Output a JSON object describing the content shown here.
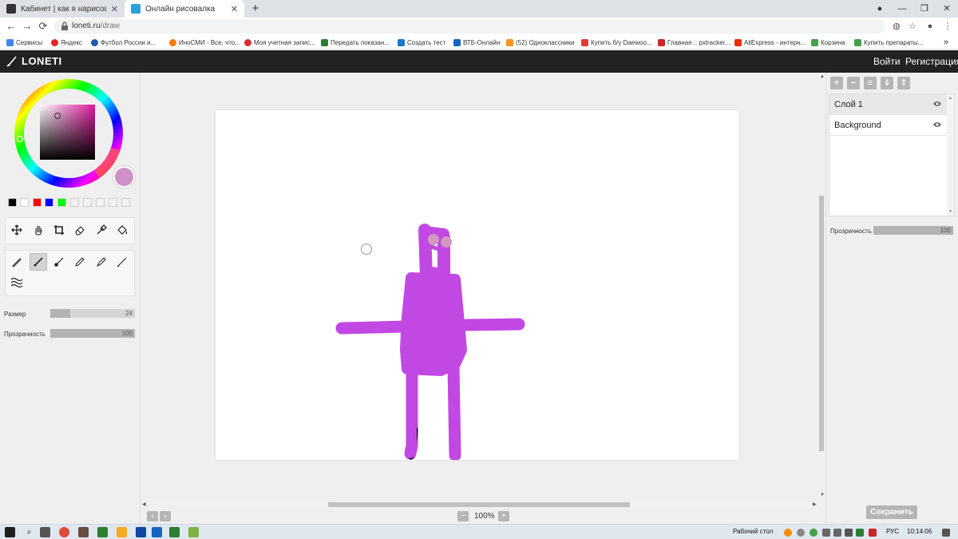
{
  "browser": {
    "tabs": [
      {
        "title": "Кабинет | как я нарисовал моб",
        "active": false
      },
      {
        "title": "Онлайн рисовалка",
        "active": true
      }
    ],
    "new_tab": "+",
    "url_domain": "loneti.ru",
    "url_path": "/draw",
    "bookmarks": [
      {
        "label": "Сервисы",
        "color": "#4285f4"
      },
      {
        "label": "Яндекс",
        "color": "#e52620"
      },
      {
        "label": "Футбол России и...",
        "color": "#1e5aa8"
      },
      {
        "label": "ИноСМИ - Все, что...",
        "color": "#f57c00"
      },
      {
        "label": "Моя учетная запис...",
        "color": "#d32f2f"
      },
      {
        "label": "Передать показан...",
        "color": "#2e7d32"
      },
      {
        "label": "Создать тест",
        "color": "#1976d2"
      },
      {
        "label": "ВТБ-Онлайн",
        "color": "#1565c0"
      },
      {
        "label": "(52) Одноклассники",
        "color": "#f7931e"
      },
      {
        "label": "Купить б/у Daewoo...",
        "color": "#e53935"
      },
      {
        "label": "Главная :: pxtracker...",
        "color": "#c62828"
      },
      {
        "label": "AliExpress - интерн...",
        "color": "#e62e04"
      },
      {
        "label": "Корзина",
        "color": "#43a047"
      },
      {
        "label": "Купить препараты...",
        "color": "#43a047"
      }
    ]
  },
  "app": {
    "logo": "LONETI",
    "login": "Войти",
    "register": "Регистрация"
  },
  "left_panel": {
    "current_color": "#d18fc7",
    "palette": [
      "#000000",
      "#ffffff",
      "#ff0000",
      "#0000ff",
      "#00ff00",
      "#f2f2f2",
      "#f2f2f2",
      "#f2f2f2",
      "#f2f2f2",
      "#f2f2f2"
    ],
    "size_label": "Размер",
    "size_value": "24",
    "size_fraction": 0.24,
    "opacity_label": "Прозрачность",
    "opacity_value": "100",
    "opacity_fraction": 1.0
  },
  "canvas": {
    "stroke_color": "#c248e4",
    "zoom": "100%",
    "zoom_out": "−",
    "zoom_in": "+"
  },
  "right_panel": {
    "layers": [
      {
        "name": "Слой 1",
        "selected": true
      },
      {
        "name": "Background",
        "selected": false
      }
    ],
    "opacity_label": "Прозрачность",
    "opacity_value": "100",
    "save": "Сохранить"
  },
  "taskbar": {
    "desktop_label": "Рабочий стол",
    "language": "РУС",
    "time": "10:14:06"
  }
}
